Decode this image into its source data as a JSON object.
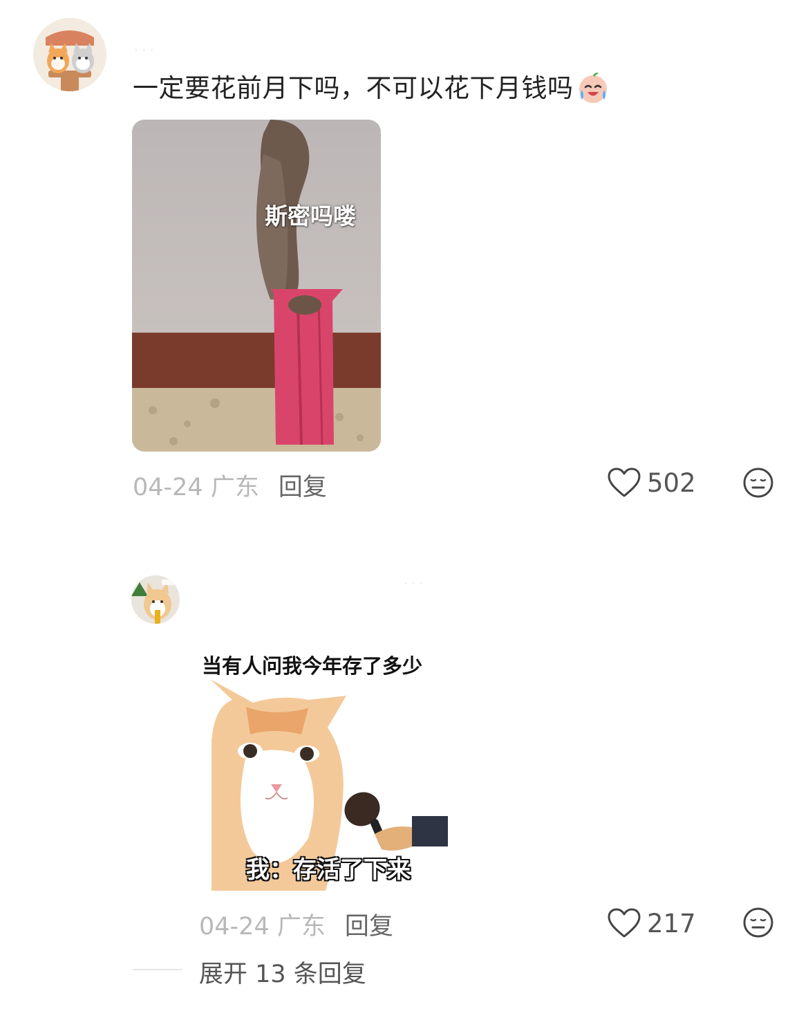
{
  "comments": [
    {
      "text": "一定要花前月下吗，不可以花下月钱吗",
      "emoji": "crying-laughing-face-icon",
      "meme_caption": "斯密吗喽",
      "date": "04-24 广东",
      "reply": "回复",
      "likes": "502"
    },
    {
      "meme_title": "当有人问我今年存了多少",
      "meme_caption": "我：存活了下来",
      "date": "04-24 广东",
      "reply": "回复",
      "likes": "217",
      "expand_replies": "展开 13 条回复"
    }
  ],
  "icons": {
    "like": "heart-outline-icon",
    "dislike": "meh-face-icon"
  },
  "colors": {
    "text": "#222222",
    "meta": "#b8b8b8",
    "secondary": "#555555"
  }
}
